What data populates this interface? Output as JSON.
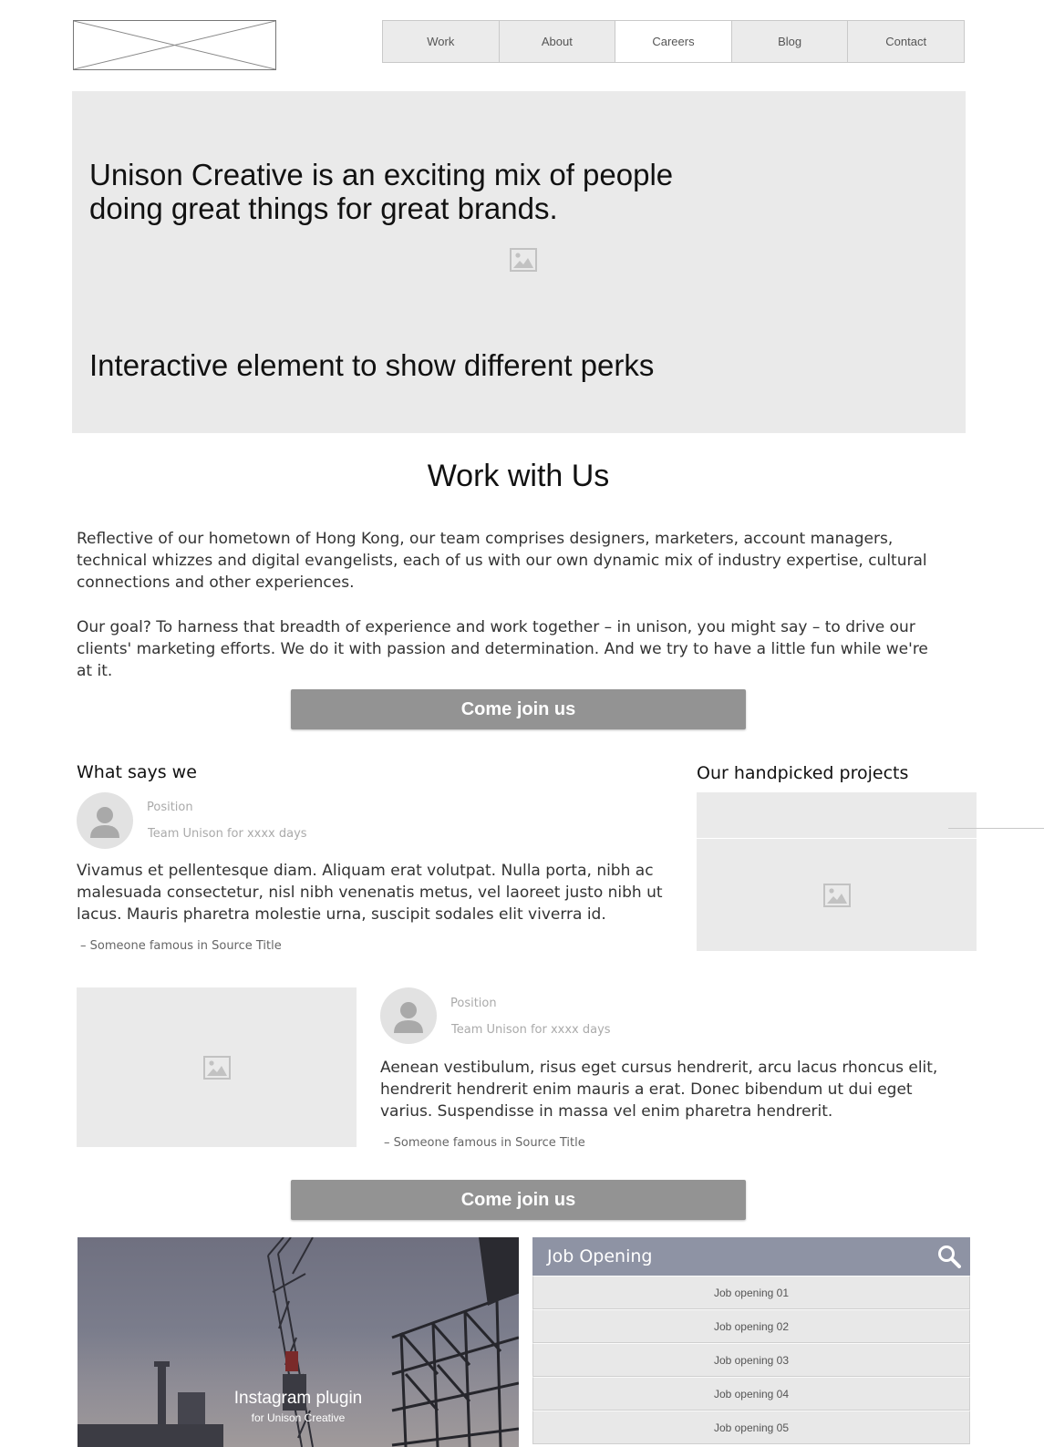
{
  "nav": {
    "items": [
      "Work",
      "About",
      "Careers",
      "Blog",
      "Contact"
    ],
    "active_index": 2
  },
  "hero": {
    "title": "Unison Creative is an exciting mix of people doing great things for great brands.",
    "perks": "Interactive element to show different perks"
  },
  "work": {
    "title": "Work with Us",
    "para1": "Reflective of our hometown of Hong Kong, our team comprises designers, marketers, account managers, technical whizzes and digital evangelists, each of us with our own dynamic mix of industry expertise, cultural connections and other experiences.",
    "para2": "Our goal? To harness that breadth of experience and work together – in unison, you might say – to drive our clients' marketing efforts. We do it with passion and determination. And we try to have a little fun while we're at it.",
    "cta": "Come join us"
  },
  "testimonials": {
    "heading": "What says we",
    "items": [
      {
        "position": "Position",
        "tenure": "Team Unison for xxxx days",
        "quote": "Vivamus et pellentesque diam. Aliquam erat volutpat. Nulla porta, nibh ac malesuada consectetur, nisl nibh venenatis metus, vel laoreet justo nibh ut lacus. Mauris pharetra molestie urna, suscipit sodales elit viverra id.",
        "source": "– Someone famous in Source Title"
      },
      {
        "position": "Position",
        "tenure": "Team Unison for xxxx days",
        "quote": "Aenean vestibulum, risus eget cursus hendrerit, arcu lacus rhoncus elit, hendrerit hendrerit enim mauris a erat. Donec bibendum ut dui eget varius. Suspendisse in massa vel enim pharetra hendrerit.",
        "source": "– Someone famous in Source Title"
      }
    ]
  },
  "projects": {
    "heading": "Our handpicked projects"
  },
  "cta2": "Come join us",
  "instagram": {
    "title": "Instagram plugin",
    "subtitle": "for Unison Creative"
  },
  "jobs": {
    "title": "Job Opening",
    "search_icon": "search-icon",
    "items": [
      "Job opening 01",
      "Job opening 02",
      "Job opening 03",
      "Job opening 04",
      "Job opening 05"
    ]
  },
  "colors": {
    "panel": "#eaeaea",
    "button": "#939393",
    "jobs_header": "#8e93a4"
  }
}
